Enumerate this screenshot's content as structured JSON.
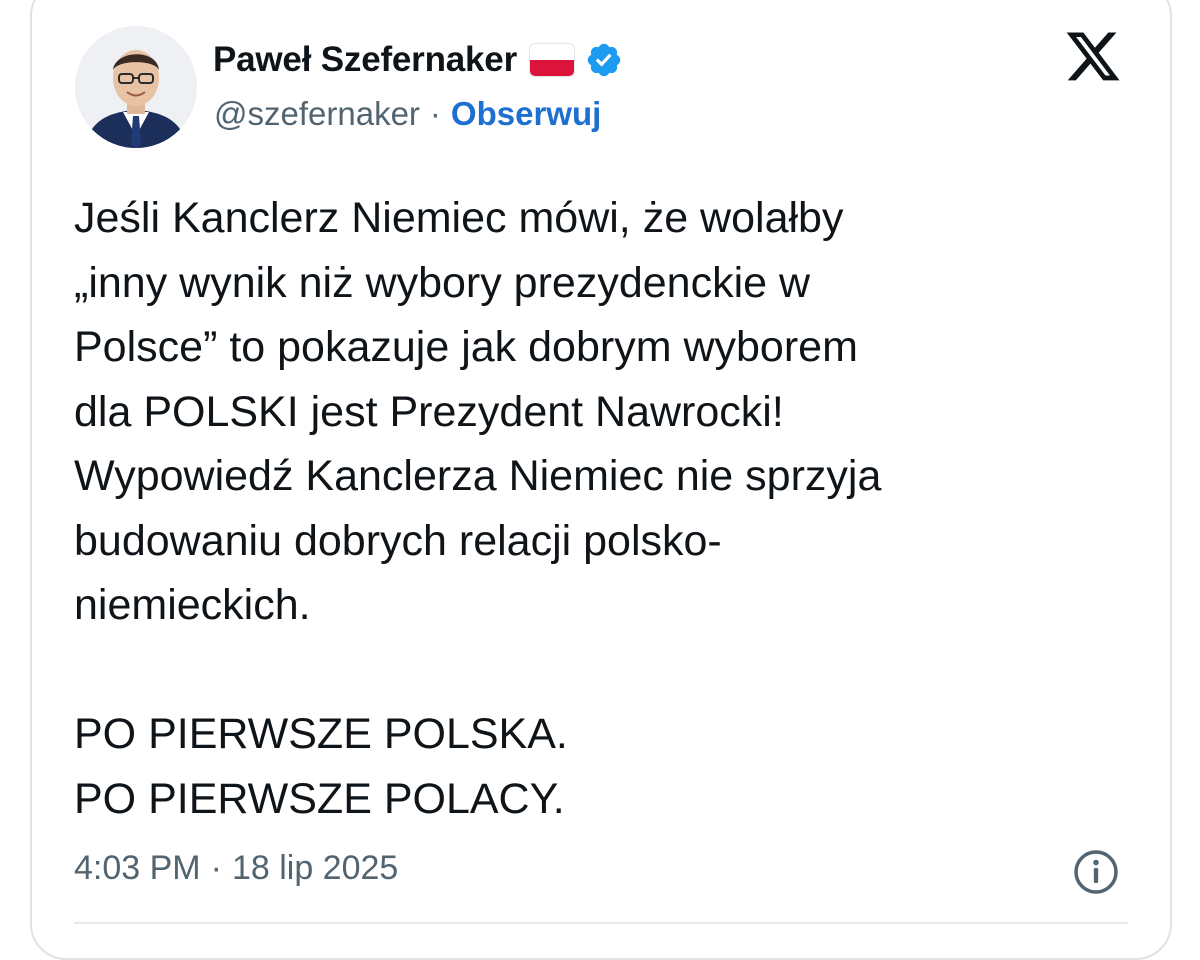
{
  "author": {
    "name": "Paweł Szefernaker",
    "handle": "@szefernaker",
    "separator": "·",
    "follow_label": "Obserwuj",
    "flag_icon": "poland-flag-icon",
    "verified_icon": "verified-badge-icon",
    "avatar_icon": "profile-photo"
  },
  "platform": {
    "logo_icon": "x-logo-icon"
  },
  "tweet": {
    "text": "Jeśli Kanclerz Niemiec mówi, że wolałby\n„inny wynik niż wybory prezydenckie w\nPolsce” to pokazuje jak dobrym wyborem\ndla POLSKI jest Prezydent Nawrocki!\nWypowiedź Kanclerza Niemiec nie sprzyja\nbudowaniu dobrych relacji polsko-\nniemieckich.\n\nPO PIERWSZE POLSKA.\nPO PIERWSZE POLACY."
  },
  "meta": {
    "time": "4:03 PM",
    "separator": "·",
    "date": "18 lip 2025",
    "info_icon": "info-icon"
  },
  "colors": {
    "text": "#0f1419",
    "secondary": "#536471",
    "link": "#1d6fd0",
    "verified": "#1d9bf0",
    "flag_red": "#dc143c",
    "border": "#dfe3e6"
  }
}
